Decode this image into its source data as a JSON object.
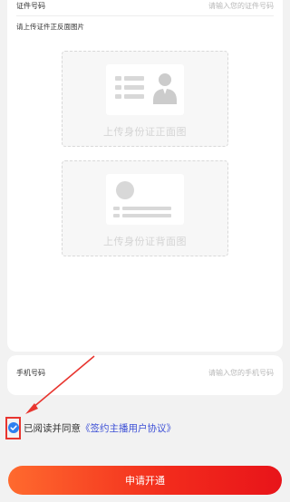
{
  "form": {
    "id_number": {
      "label": "证件号码",
      "placeholder": "请输入您的证件号码",
      "value": ""
    },
    "upload_section_label": "请上传证件正反面图片",
    "upload_front": {
      "text": "上传身份证正面图",
      "icon": "id-card-front-icon"
    },
    "upload_back": {
      "text": "上传身份证背面图",
      "icon": "id-card-back-icon"
    },
    "phone": {
      "label": "手机号码",
      "placeholder": "请输入您的手机号码",
      "value": ""
    }
  },
  "agreement": {
    "checked": true,
    "prefix_text": "已阅读并同意",
    "link_text": "《签约主播用户协议》",
    "check_icon": "checkmark-circle-icon"
  },
  "submit": {
    "label": "申请开通"
  },
  "colors": {
    "accent": "#e8352f",
    "check_blue": "#2d7ff0",
    "link": "#3d50d6",
    "button_start": "#ff6a2e",
    "button_end": "#e8141a"
  }
}
